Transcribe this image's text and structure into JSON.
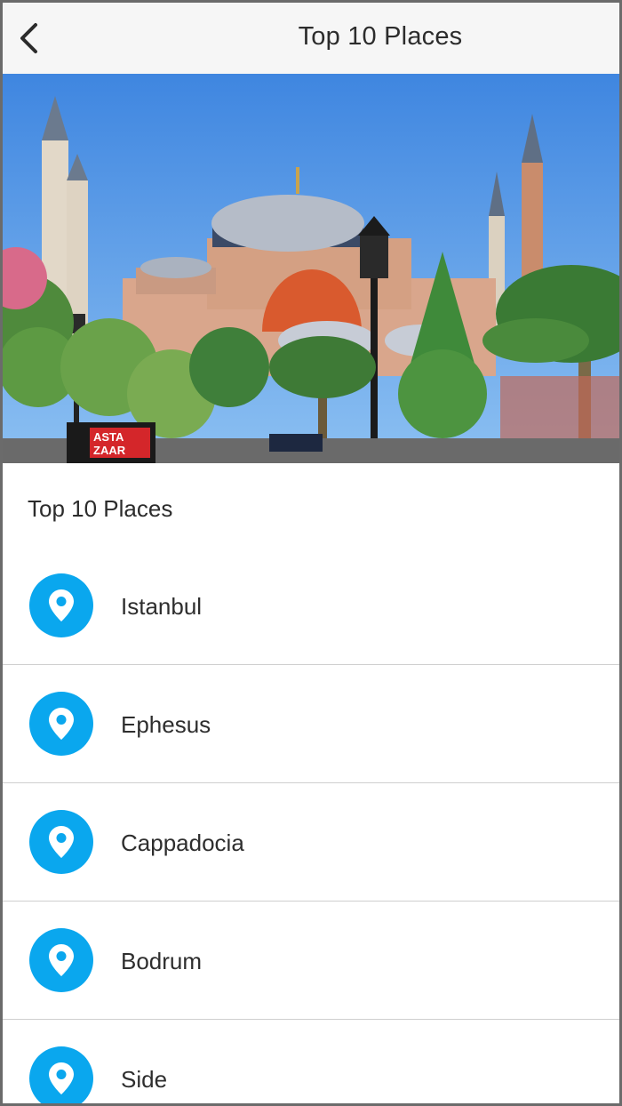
{
  "header": {
    "title": "Top 10 Places",
    "back_icon": "chevron-left-icon"
  },
  "hero": {
    "sign_text_line1": "ASTA",
    "sign_text_line2": "ZAAR"
  },
  "section": {
    "title": "Top 10 Places"
  },
  "places": [
    {
      "label": "Istanbul",
      "icon": "location-pin-icon"
    },
    {
      "label": "Ephesus",
      "icon": "location-pin-icon"
    },
    {
      "label": "Cappadocia",
      "icon": "location-pin-icon"
    },
    {
      "label": "Bodrum",
      "icon": "location-pin-icon"
    },
    {
      "label": "Side",
      "icon": "location-pin-icon"
    }
  ],
  "colors": {
    "accent": "#0aa7ee",
    "sky": "#4a8fe0",
    "text": "#2c2c2c"
  }
}
